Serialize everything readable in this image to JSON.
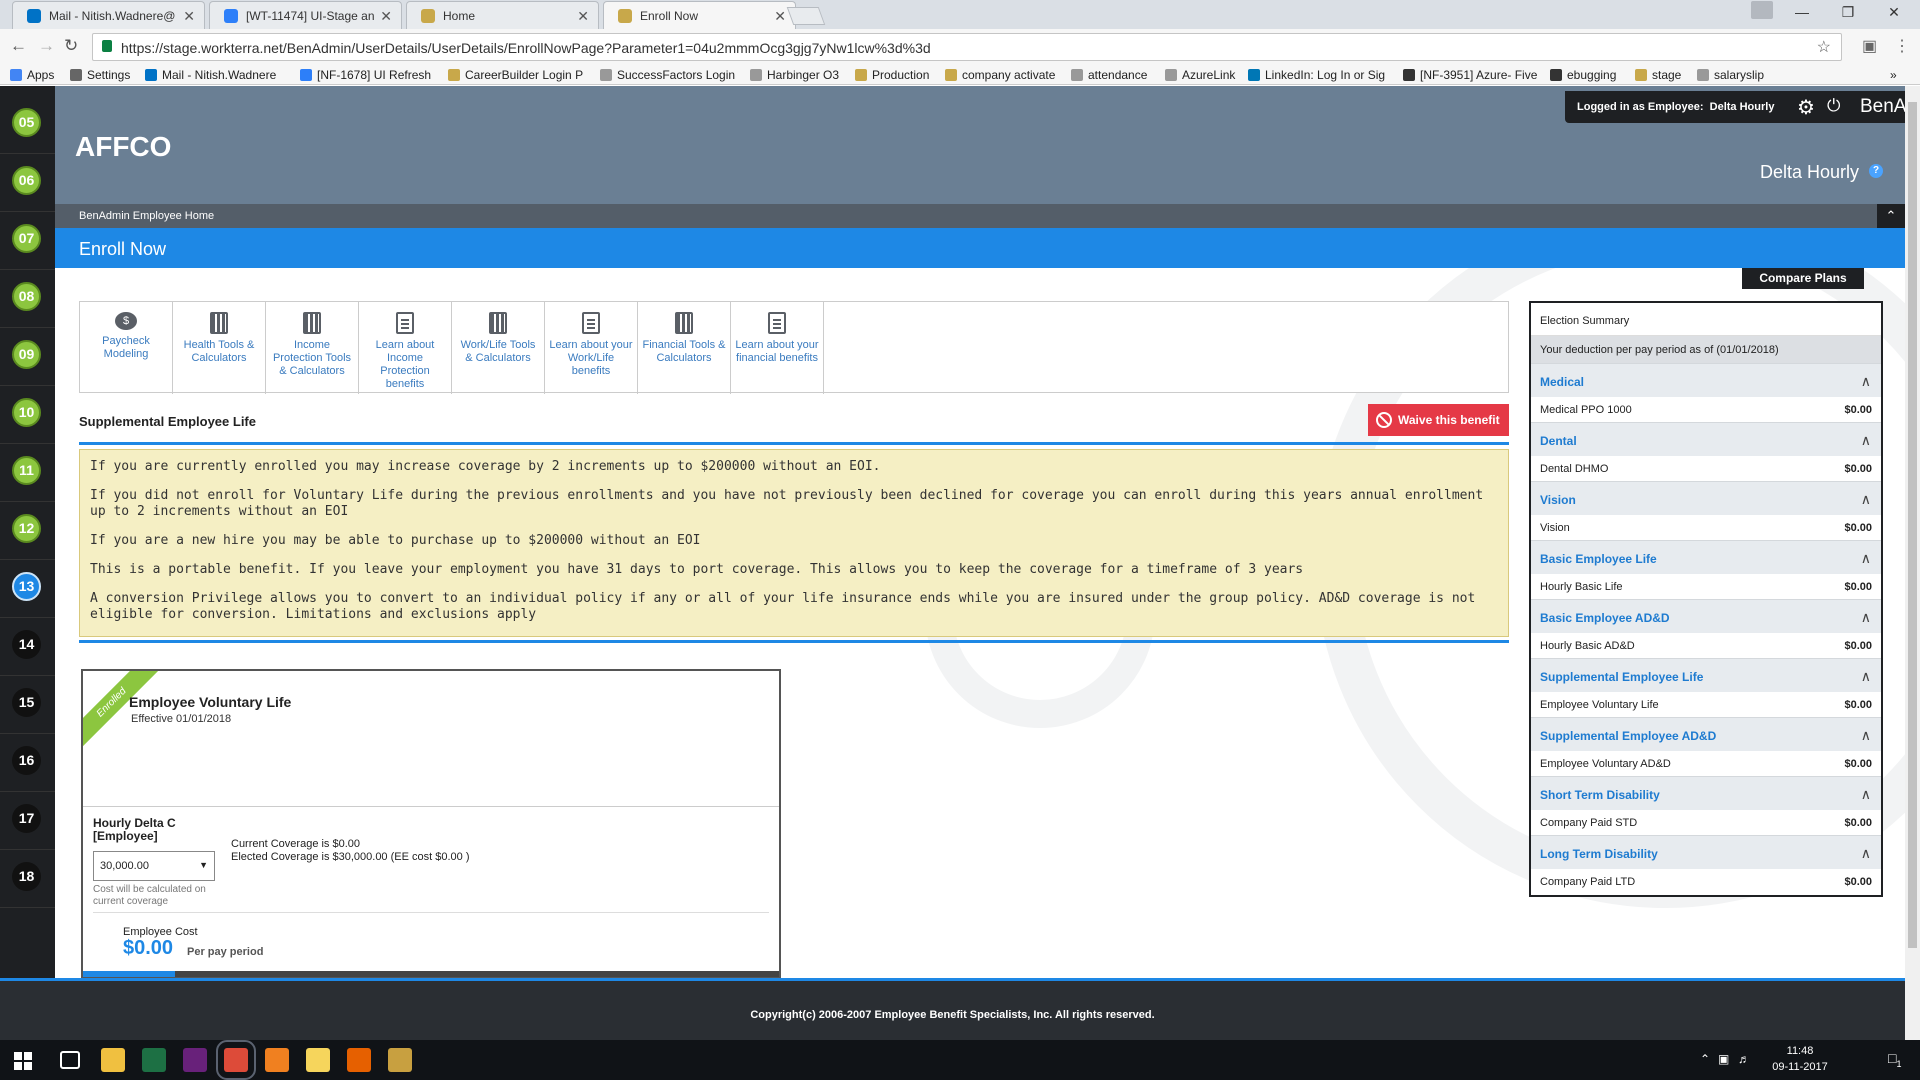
{
  "browser": {
    "tabs": [
      {
        "title": "Mail - Nitish.Wadnere@",
        "icon_color": "#0072c6",
        "active": false
      },
      {
        "title": "[WT-11474] UI-Stage an",
        "icon_color": "#2d7ff9",
        "active": false
      },
      {
        "title": "Home",
        "icon_color": "#c8a84a",
        "active": false
      },
      {
        "title": "Enroll Now",
        "icon_color": "#c8a84a",
        "active": true
      }
    ],
    "url": "https://stage.workterra.net/BenAdmin/UserDetails/UserDetails/EnrollNowPage?Parameter1=04u2mmmOcg3gjg7yNw1lcw%3d%3d",
    "bookmarks": [
      {
        "label": "Apps",
        "icon_color": "#4285f4"
      },
      {
        "label": "Settings",
        "icon_color": "#666666"
      },
      {
        "label": "Mail - Nitish.Wadnere",
        "icon_color": "#0072c6"
      },
      {
        "label": "[NF-1678] UI Refresh",
        "icon_color": "#2d7ff9"
      },
      {
        "label": "CareerBuilder Login P",
        "icon_color": "#c8a84a"
      },
      {
        "label": "SuccessFactors Login",
        "icon_color": "#999999"
      },
      {
        "label": "Harbinger O3",
        "icon_color": "#999999"
      },
      {
        "label": "Production",
        "icon_color": "#c8a84a"
      },
      {
        "label": "company activate",
        "icon_color": "#c8a84a"
      },
      {
        "label": "attendance",
        "icon_color": "#999999"
      },
      {
        "label": "AzureLink",
        "icon_color": "#999999"
      },
      {
        "label": "LinkedIn: Log In or Sig",
        "icon_color": "#0077b5"
      },
      {
        "label": "[NF-3951] Azure- Five",
        "icon_color": "#333333"
      },
      {
        "label": "ebugging",
        "icon_color": "#333333"
      },
      {
        "label": "stage",
        "icon_color": "#c8a84a"
      },
      {
        "label": "salaryslip",
        "icon_color": "#999999"
      }
    ]
  },
  "rail": {
    "steps": [
      {
        "num": "05",
        "state": "done"
      },
      {
        "num": "06",
        "state": "done"
      },
      {
        "num": "07",
        "state": "done"
      },
      {
        "num": "08",
        "state": "done"
      },
      {
        "num": "09",
        "state": "done"
      },
      {
        "num": "10",
        "state": "done"
      },
      {
        "num": "11",
        "state": "done"
      },
      {
        "num": "12",
        "state": "done"
      },
      {
        "num": "13",
        "state": "current"
      },
      {
        "num": "14",
        "state": "pending"
      },
      {
        "num": "15",
        "state": "pending"
      },
      {
        "num": "16",
        "state": "pending"
      },
      {
        "num": "17",
        "state": "pending"
      },
      {
        "num": "18",
        "state": "pending"
      }
    ]
  },
  "header": {
    "company": "AFFCO",
    "logged_in_prefix": "Logged in as Employee:",
    "logged_in_user": "Delta Hourly",
    "brand": "BenAdmin",
    "user_name": "Delta Hourly",
    "breadcrumb": "BenAdmin Employee Home",
    "page_title": "Enroll Now"
  },
  "tools": [
    {
      "label": "Paycheck Modeling",
      "icon": "coin"
    },
    {
      "label": "Health Tools & Calculators",
      "icon": "calc"
    },
    {
      "label": "Income Protection Tools & Calculators",
      "icon": "calc"
    },
    {
      "label": "Learn about Income Protection benefits",
      "icon": "doc"
    },
    {
      "label": "Work/Life Tools & Calculators",
      "icon": "calc"
    },
    {
      "label": "Learn about your Work/Life benefits",
      "icon": "doc"
    },
    {
      "label": "Financial Tools & Calculators",
      "icon": "calc"
    },
    {
      "label": "Learn about your financial benefits",
      "icon": "doc"
    }
  ],
  "section": {
    "title": "Supplemental Employee Life",
    "waive_label": "Waive this benefit",
    "notice": [
      "If you are currently enrolled you may increase coverage by 2 increments up to $200000 without an EOI.",
      "If you did not enroll for Voluntary Life during the previous enrollments and you have not previously been declined for coverage you can enroll during this years annual enrollment up to 2 increments without an EOI",
      "If you are a new hire you may be able to purchase up to $200000 without an EOI",
      "This is a portable benefit. If you leave your employment you have 31 days to port coverage. This allows you to keep the coverage for a timeframe of 3 years",
      "A conversion Privilege allows you to convert to an individual policy if any or all of your life insurance ends while you are insured under the group policy. AD&D coverage is not eligible for conversion. Limitations and exclusions apply"
    ]
  },
  "plan": {
    "ribbon": "Enrolled",
    "name": "Employee Voluntary Life",
    "effective": "Effective 01/01/2018",
    "coverage_label": "Hourly Delta C [Employee]",
    "coverage_value": "30,000.00",
    "coverage_note": "Cost will be calculated on current coverage",
    "current_coverage": "Current Coverage is $0.00",
    "elected_coverage": "Elected Coverage is $30,000.00 (EE cost $0.00 )",
    "cost_label": "Employee Cost",
    "cost_value": "$0.00",
    "cost_period": "Per pay period"
  },
  "summary": {
    "compare_label": "Compare Plans",
    "title": "Election Summary",
    "subtitle": "Your deduction per pay period as of (01/01/2018)",
    "groups": [
      {
        "heading": "Medical",
        "item": "Medical PPO 1000",
        "amount": "$0.00"
      },
      {
        "heading": "Dental",
        "item": "Dental DHMO",
        "amount": "$0.00"
      },
      {
        "heading": "Vision",
        "item": "Vision",
        "amount": "$0.00"
      },
      {
        "heading": "Basic Employee Life",
        "item": "Hourly Basic Life",
        "amount": "$0.00"
      },
      {
        "heading": "Basic Employee AD&D",
        "item": "Hourly Basic AD&D",
        "amount": "$0.00"
      },
      {
        "heading": "Supplemental Employee Life",
        "item": "Employee Voluntary Life",
        "amount": "$0.00"
      },
      {
        "heading": "Supplemental Employee AD&D",
        "item": "Employee Voluntary AD&D",
        "amount": "$0.00"
      },
      {
        "heading": "Short Term Disability",
        "item": "Company Paid STD",
        "amount": "$0.00"
      },
      {
        "heading": "Long Term Disability",
        "item": "Company Paid LTD",
        "amount": "$0.00"
      }
    ]
  },
  "footer": {
    "copyright": "Copyright(c) 2006-2007 Employee Benefit Specialists, Inc. All rights reserved."
  },
  "taskbar": {
    "apps": [
      {
        "name": "task-view",
        "color": "#101317"
      },
      {
        "name": "file-explorer",
        "color": "#f0c040"
      },
      {
        "name": "excel",
        "color": "#1d7044"
      },
      {
        "name": "visual-studio",
        "color": "#68217a"
      },
      {
        "name": "chrome",
        "color": "#dd4b39"
      },
      {
        "name": "burn-app",
        "color": "#f08020"
      },
      {
        "name": "sticky-notes",
        "color": "#f6d55c"
      },
      {
        "name": "firefox",
        "color": "#e66000"
      },
      {
        "name": "tools-app",
        "color": "#c8a040"
      }
    ],
    "time": "11:48",
    "date": "09-11-2017",
    "notifications": "1"
  },
  "colors": {
    "accent": "#1e88e5",
    "done_step": "#8cc63f",
    "waive": "#e53946",
    "header": "#6a7f94"
  }
}
